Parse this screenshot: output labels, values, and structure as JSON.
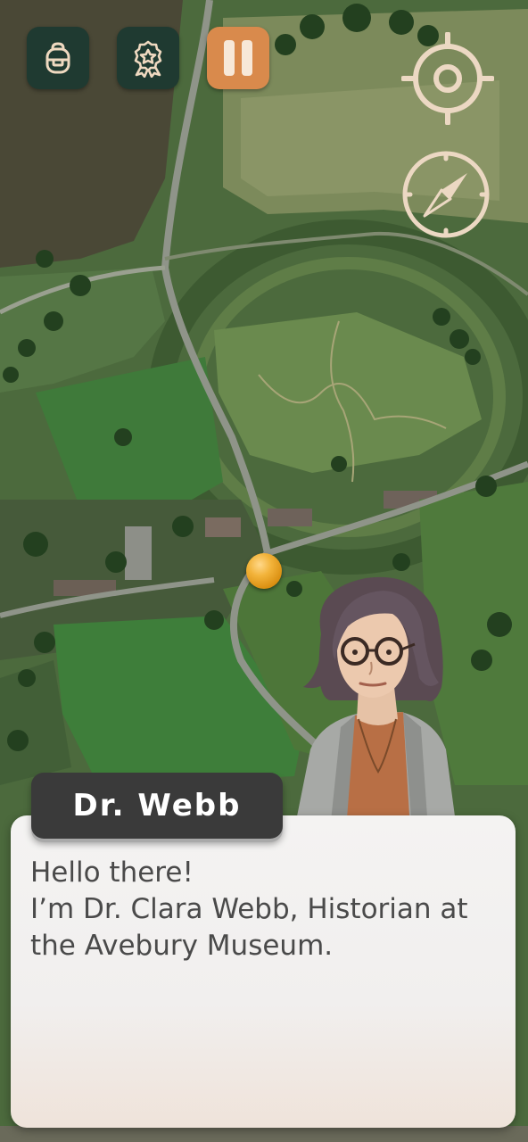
{
  "hud": {
    "backpack_icon": "backpack-icon",
    "achievements_icon": "badge-icon",
    "pause_icon": "pause-icon",
    "locate_icon": "crosshair-icon",
    "compass_icon": "compass-icon"
  },
  "colors": {
    "hud_dark": "#1f3a31",
    "hud_orange": "#d98a4c",
    "hud_icon_light": "#efd9c0",
    "map_control": "#ecd8c3",
    "name_tag_bg": "#3a3a3a",
    "dialog_bg": "#f3f2f1",
    "dialog_text": "#4a4a4a",
    "marker": "#f2b33a"
  },
  "dialog": {
    "speaker": "Dr. Webb",
    "lines": [
      "Hello there!",
      "I’m Dr. Clara Webb, Historian at",
      "the Avebury Museum."
    ]
  }
}
